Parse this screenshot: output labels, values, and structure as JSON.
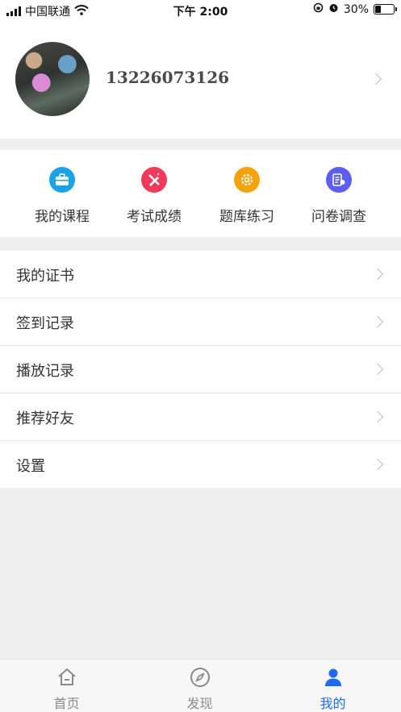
{
  "status_bar": {
    "carrier": "中国联通",
    "time": "下午 2:00",
    "battery_percent": "30%",
    "battery_level": 0.3
  },
  "profile": {
    "phone": "13226073126"
  },
  "quick_actions": [
    {
      "label": "我的课程",
      "icon": "briefcase-icon",
      "color": "#1aa3e8"
    },
    {
      "label": "考试成绩",
      "icon": "pencil-ruler-icon",
      "color": "#ee3b5b"
    },
    {
      "label": "题库练习",
      "icon": "gear-icon",
      "color": "#f5a30d"
    },
    {
      "label": "问卷调查",
      "icon": "survey-icon",
      "color": "#5b5ef0"
    }
  ],
  "menu": [
    {
      "label": "我的证书"
    },
    {
      "label": "签到记录"
    },
    {
      "label": "播放记录"
    },
    {
      "label": "推荐好友"
    },
    {
      "label": "设置"
    }
  ],
  "tabs": [
    {
      "label": "首页",
      "icon": "home-icon",
      "active": false
    },
    {
      "label": "发现",
      "icon": "compass-icon",
      "active": false
    },
    {
      "label": "我的",
      "icon": "person-icon",
      "active": true
    }
  ],
  "colors": {
    "accent": "#1f6bf0",
    "inactive_tab": "#8a8a8a"
  }
}
